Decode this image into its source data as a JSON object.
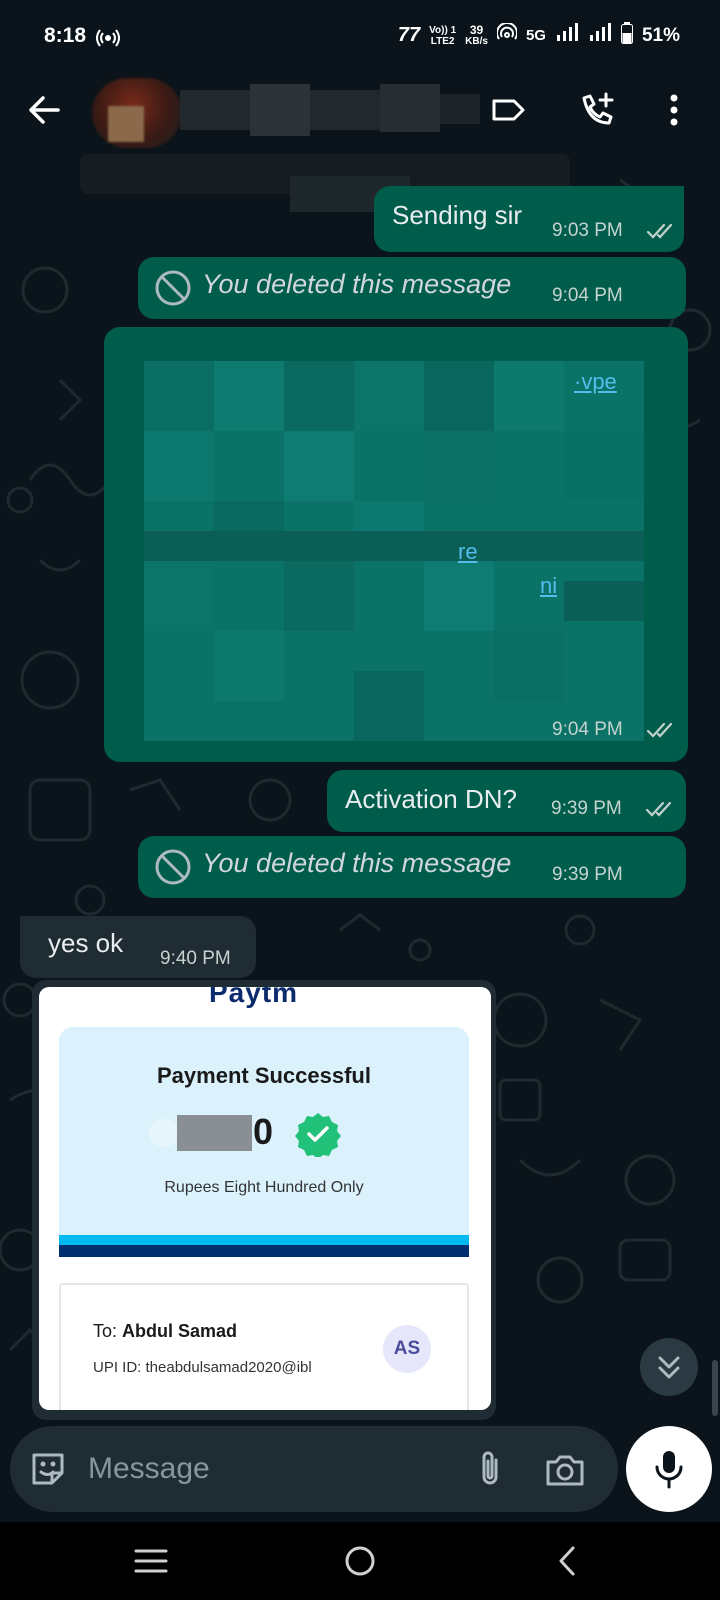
{
  "status_bar": {
    "time": "8:18",
    "carrier_mark": "77",
    "volte": "Vo)) 1\nLTE2",
    "speed_value": "39",
    "speed_unit": "KB/s",
    "network": "5G",
    "battery": "51%"
  },
  "header": {
    "contact_name": "",
    "icons": [
      "back-arrow-icon",
      "label-icon",
      "add-call-icon",
      "more-vert-icon"
    ]
  },
  "messages": [
    {
      "direction": "outgoing",
      "text": "Sending sir",
      "time": "9:03 PM",
      "status": "read"
    },
    {
      "direction": "outgoing",
      "deleted": true,
      "text": "You deleted this message",
      "time": "9:04 PM"
    },
    {
      "direction": "outgoing",
      "redacted": true,
      "link_fragments": [
        "·vpe",
        "re",
        "ni"
      ],
      "time": "9:04 PM",
      "status": "read"
    },
    {
      "direction": "outgoing",
      "text": "Activation DN?",
      "time": "9:39 PM",
      "status": "read"
    },
    {
      "direction": "outgoing",
      "deleted": true,
      "text": "You deleted this message",
      "time": "9:39 PM"
    },
    {
      "direction": "incoming",
      "text": "yes ok",
      "time": "9:40 PM"
    }
  ],
  "payment_card": {
    "brand": "Paytm",
    "title": "Payment Successful",
    "amount_visible_digit": "0",
    "amount_words": "Rupees Eight Hundred Only",
    "to_label": "To:",
    "to_name": "Abdul Samad",
    "upi_label": "UPI ID:",
    "upi_id": "theabdulsamad2020@ibl",
    "initials": "AS"
  },
  "composer": {
    "placeholder": "Message"
  },
  "colors": {
    "background": "#0b141a",
    "outgoing_bubble": "#005c4b",
    "incoming_bubble": "#202c33",
    "read_ticks": "#c5d3cf",
    "link": "#53bdeb"
  }
}
